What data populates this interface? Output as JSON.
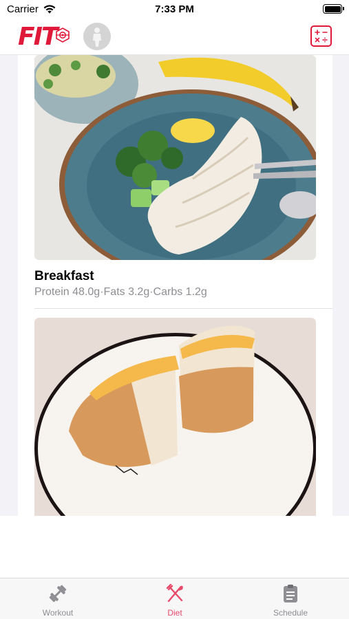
{
  "status_bar": {
    "carrier": "Carrier",
    "time": "7:33 PM"
  },
  "nav": {
    "logo_text": "FIT",
    "logo_icon": "target-icon",
    "avatar_icon": "avatar-icon",
    "right_button_icon": "calculator-icon",
    "accent": "#e0193a"
  },
  "meals": [
    {
      "title": "Breakfast",
      "protein": "Protein 48.0g",
      "fats": "Fats 3.2g",
      "carbs": "Carbs 1.2g",
      "separator": "·",
      "image_icon": "grilled-chicken-plate-photo"
    },
    {
      "image_icon": "orange-cake-plate-photo"
    }
  ],
  "tabs": [
    {
      "label": "Workout",
      "icon": "dumbbell-icon",
      "active": false
    },
    {
      "label": "Diet",
      "icon": "fork-knife-icon",
      "active": true
    },
    {
      "label": "Schedule",
      "icon": "clipboard-icon",
      "active": false
    }
  ],
  "colors": {
    "active_tab": "#e84a6a",
    "inactive_tab": "#8e8e93"
  }
}
